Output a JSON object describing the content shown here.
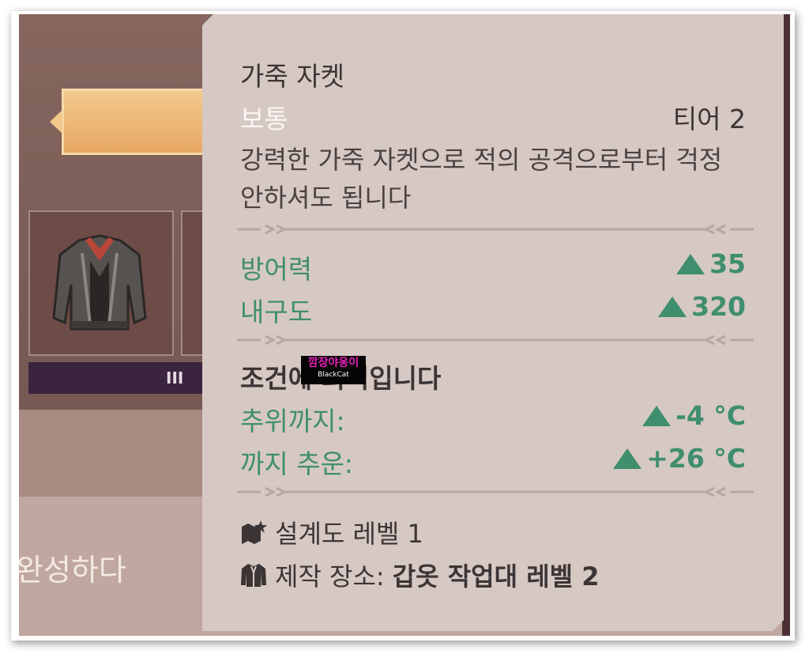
{
  "background": {
    "slot_bar_label": "III",
    "bottom_text": "완성하다"
  },
  "tooltip": {
    "title": "가죽 자켓",
    "rarity": "보통",
    "tier": "티어 2",
    "description": "강력한 가죽 자켓으로 적의 공격으로부터 걱정 안하셔도 됩니다",
    "stats": [
      {
        "label": "방어력",
        "value": "35"
      },
      {
        "label": "내구도",
        "value": "320"
      }
    ],
    "conditions_title": "조건에 최적입니다",
    "conditions": [
      {
        "label": "추위까지:",
        "value": "-4 °C"
      },
      {
        "label": "까지 추운:",
        "value": "+26 °C"
      }
    ],
    "blueprint_level": "설계도 레벨 1",
    "craft_location_label": "제작 장소:",
    "craft_location_value": "갑옷 작업대 레벨 2"
  },
  "watermark": {
    "line1": "깜장야옹이",
    "line2": "BlackCat"
  },
  "colors": {
    "tooltip_bg": "#d6c8c3",
    "stat_green": "#3f8e6e",
    "rarity_white": "#fbf6f4"
  }
}
